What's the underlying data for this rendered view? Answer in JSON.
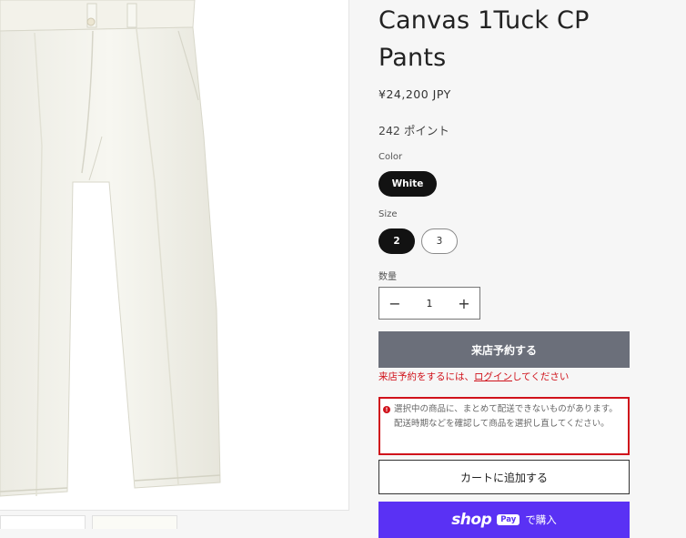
{
  "product": {
    "title": "Canvas 1Tuck CP Pants",
    "price": "¥24,200 JPY",
    "points": "242 ポイント"
  },
  "options": {
    "color_label": "Color",
    "color_selected": "White",
    "size_label": "Size",
    "sizes": [
      "2",
      "3"
    ],
    "size_selected": "2"
  },
  "quantity": {
    "label": "数量",
    "value": "1",
    "minus": "−",
    "plus": "+"
  },
  "actions": {
    "reserve_label": "来店予約する",
    "login_note_prefix": "来店予約をするには、",
    "login_link": "ログイン",
    "login_note_suffix": "してください",
    "warning_icon": "!",
    "warning_text": "選択中の商品に、まとめて配送できないものがあります。配送時期などを確認して商品を選択し直してください。",
    "add_to_cart": "カートに追加する",
    "shop_logo": "shop",
    "shop_pay_badge": "Pay",
    "shop_buy": "で購入"
  },
  "colors": {
    "primary_dark": "#121212",
    "disabled_button": "#6b6f7a",
    "error_red": "#d0121b",
    "shop_purple": "#5a31f4",
    "background": "#f6f6f6"
  }
}
